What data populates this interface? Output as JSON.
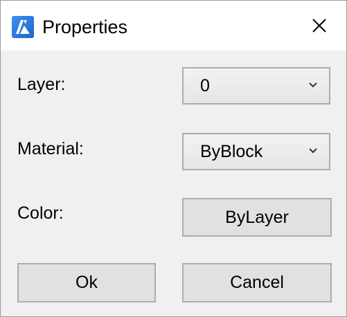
{
  "window": {
    "title": "Properties",
    "app_icon": "bricscad-logo-icon",
    "close_icon": "close-icon"
  },
  "fields": {
    "layer": {
      "label": "Layer:",
      "value": "0"
    },
    "material": {
      "label": "Material:",
      "value": "ByBlock"
    },
    "color": {
      "label": "Color:",
      "value": "ByLayer"
    }
  },
  "buttons": {
    "ok": "Ok",
    "cancel": "Cancel"
  },
  "colors": {
    "dialog_background": "#f0f0f0",
    "titlebar_background": "#ffffff",
    "button_face": "#e1e1e1",
    "button_border": "#adadad",
    "app_icon_blue": "#2b7de9"
  }
}
